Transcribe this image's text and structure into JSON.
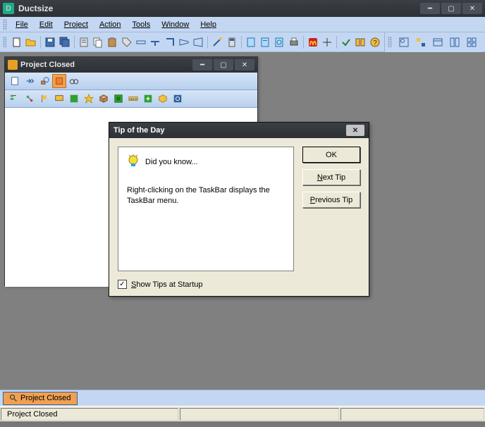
{
  "app": {
    "title": "Ductsize"
  },
  "menu": {
    "file": "File",
    "edit": "Edit",
    "project": "Project",
    "action": "Action",
    "tools": "Tools",
    "window": "Window",
    "help": "Help"
  },
  "childWindow": {
    "title": "Project Closed"
  },
  "tip": {
    "dialogTitle": "Tip of the Day",
    "heading": "Did you know...",
    "body": "Right-clicking on the TaskBar displays the TaskBar menu.",
    "ok": "OK",
    "next": "Next Tip",
    "prev": "Previous Tip",
    "checkbox": "Show Tips at Startup",
    "checked": true
  },
  "taskbar": {
    "button": "Project Closed"
  },
  "status": {
    "text": "Project Closed"
  }
}
